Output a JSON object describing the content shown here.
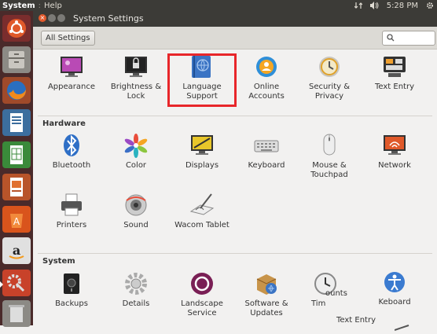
{
  "top_panel": {
    "menu_system": "System",
    "menu_help": "Help",
    "time": "5:28 PM"
  },
  "window": {
    "title": "System Settings"
  },
  "toolbar": {
    "all_settings": "All Settings"
  },
  "personal": [
    {
      "label": "Appearance"
    },
    {
      "label": "Brightness &\nLock"
    },
    {
      "label": "Language\nSupport"
    },
    {
      "label": "Online\nAccounts"
    },
    {
      "label": "Security &\nPrivacy"
    },
    {
      "label": "Text Entry"
    }
  ],
  "hardware": {
    "title": "Hardware",
    "items": [
      {
        "label": "Bluetooth"
      },
      {
        "label": "Color"
      },
      {
        "label": "Displays"
      },
      {
        "label": "Keyboard"
      },
      {
        "label": "Mouse &\nTouchpad"
      },
      {
        "label": "Network"
      },
      {
        "label": "Printers"
      },
      {
        "label": "Sound"
      },
      {
        "label": "Wacom Tablet"
      }
    ]
  },
  "system": {
    "title": "System",
    "items": [
      {
        "label": "Backups"
      },
      {
        "label": "Details"
      },
      {
        "label": "Landscape\nService"
      },
      {
        "label": "Software &\nUpdates"
      },
      {
        "label": "Tim"
      },
      {
        "label": "Keboard"
      }
    ],
    "overlay_counts": "ounts",
    "overlay_text_entry": "Text Entry"
  },
  "colors": {
    "panel": "#3c3b37",
    "highlight": "#e8262a",
    "launcher": "#4a2a2a"
  }
}
